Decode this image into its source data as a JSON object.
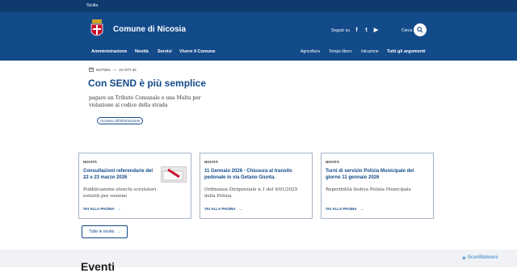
{
  "topbar": {
    "region": "Sicilia"
  },
  "header": {
    "site_title": "Comune di Nicosia",
    "follow_label": "Seguici su",
    "social": [
      {
        "name": "facebook-icon",
        "glyph": "f"
      },
      {
        "name": "twitter-icon",
        "glyph": "t"
      },
      {
        "name": "youtube-icon",
        "glyph": "▶"
      }
    ],
    "search_label": "Cerca"
  },
  "nav": {
    "main": [
      "Amministrazione",
      "Novità",
      "Servizi",
      "Vivere il Comune"
    ],
    "right": [
      "Agricoltura",
      "Tempo libero",
      "Istruzione"
    ],
    "all_topics": "Tutti gli argomenti"
  },
  "hero": {
    "tag": "NOTIZIA",
    "date": "24 OTT 25",
    "title": "Con SEND è più semplice",
    "description": "pagare un Tributo Comunale o una Multa per violazione al codice della strada",
    "link": "Accesso all'informazione"
  },
  "cards": [
    {
      "tag": "NOVITÀ",
      "title": "Consultazioni referendarie del 22 e 23 marzo 2026",
      "description": "Pubblicazione elenchi scrutatori estratti per sezione",
      "link": "VAI ALLA PAGINA"
    },
    {
      "tag": "NOVITÀ",
      "title": "11 Gennaio 2026 - Chiusura al transito pedonale in via Getano Giunta.",
      "description": "Ordinanza Dirigenziale n.1 del 9/01/2025 della Polizia",
      "link": "VAI ALLA PAGINA"
    },
    {
      "tag": "NOVITÀ",
      "title": "Turni di servizio Polizia Municipale del giorno 11 gennaio 2026",
      "description": "Reperibilità festiva Polizia Municipale",
      "link": "VAI ALLA PAGINA"
    }
  ],
  "all_news": "Tutte le novità",
  "events_title": "Eventi",
  "watermark": "ScanMalware",
  "colors": {
    "primary": "#134a8a",
    "topbar": "#0e3a6e"
  }
}
